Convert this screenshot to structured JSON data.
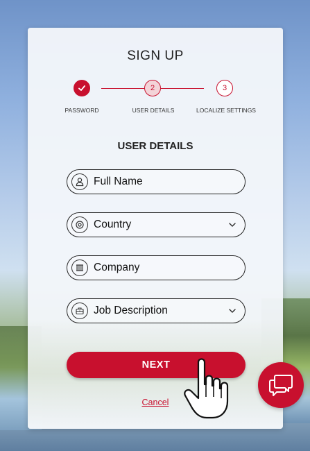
{
  "signup": {
    "title": "SIGN UP",
    "steps": [
      {
        "label": "PASSWORD",
        "state": "done",
        "number": ""
      },
      {
        "label": "USER DETAILS",
        "state": "current",
        "number": "2"
      },
      {
        "label": "LOCALIZE SETTINGS",
        "state": "pending",
        "number": "3"
      }
    ],
    "section_heading": "USER DETAILS",
    "fields": [
      {
        "label": "Full Name",
        "icon": "user-icon",
        "dropdown": false
      },
      {
        "label": "Country",
        "icon": "location-pin-icon",
        "dropdown": true
      },
      {
        "label": "Company",
        "icon": "building-icon",
        "dropdown": false
      },
      {
        "label": "Job Description",
        "icon": "briefcase-icon",
        "dropdown": true
      }
    ],
    "next_label": "NEXT",
    "cancel_label": "Cancel"
  },
  "colors": {
    "accent": "#c8102e",
    "card": "#f3f6fa",
    "text": "#222222"
  },
  "chat": {
    "icon": "chat-bubbles-icon"
  },
  "cursor": {
    "icon": "hand-pointer-icon"
  }
}
